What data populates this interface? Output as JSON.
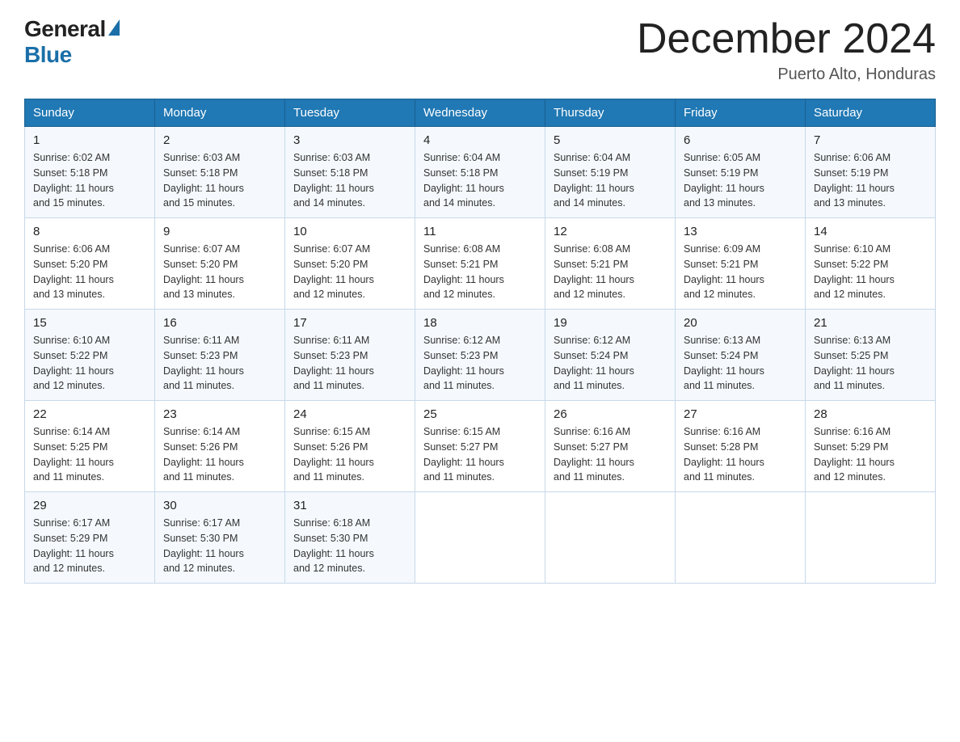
{
  "header": {
    "logo": {
      "text_general": "General",
      "text_blue": "Blue"
    },
    "title": "December 2024",
    "location": "Puerto Alto, Honduras"
  },
  "days_of_week": [
    "Sunday",
    "Monday",
    "Tuesday",
    "Wednesday",
    "Thursday",
    "Friday",
    "Saturday"
  ],
  "weeks": [
    [
      {
        "day": "1",
        "sunrise": "6:02 AM",
        "sunset": "5:18 PM",
        "daylight": "11 hours and 15 minutes."
      },
      {
        "day": "2",
        "sunrise": "6:03 AM",
        "sunset": "5:18 PM",
        "daylight": "11 hours and 15 minutes."
      },
      {
        "day": "3",
        "sunrise": "6:03 AM",
        "sunset": "5:18 PM",
        "daylight": "11 hours and 14 minutes."
      },
      {
        "day": "4",
        "sunrise": "6:04 AM",
        "sunset": "5:18 PM",
        "daylight": "11 hours and 14 minutes."
      },
      {
        "day": "5",
        "sunrise": "6:04 AM",
        "sunset": "5:19 PM",
        "daylight": "11 hours and 14 minutes."
      },
      {
        "day": "6",
        "sunrise": "6:05 AM",
        "sunset": "5:19 PM",
        "daylight": "11 hours and 13 minutes."
      },
      {
        "day": "7",
        "sunrise": "6:06 AM",
        "sunset": "5:19 PM",
        "daylight": "11 hours and 13 minutes."
      }
    ],
    [
      {
        "day": "8",
        "sunrise": "6:06 AM",
        "sunset": "5:20 PM",
        "daylight": "11 hours and 13 minutes."
      },
      {
        "day": "9",
        "sunrise": "6:07 AM",
        "sunset": "5:20 PM",
        "daylight": "11 hours and 13 minutes."
      },
      {
        "day": "10",
        "sunrise": "6:07 AM",
        "sunset": "5:20 PM",
        "daylight": "11 hours and 12 minutes."
      },
      {
        "day": "11",
        "sunrise": "6:08 AM",
        "sunset": "5:21 PM",
        "daylight": "11 hours and 12 minutes."
      },
      {
        "day": "12",
        "sunrise": "6:08 AM",
        "sunset": "5:21 PM",
        "daylight": "11 hours and 12 minutes."
      },
      {
        "day": "13",
        "sunrise": "6:09 AM",
        "sunset": "5:21 PM",
        "daylight": "11 hours and 12 minutes."
      },
      {
        "day": "14",
        "sunrise": "6:10 AM",
        "sunset": "5:22 PM",
        "daylight": "11 hours and 12 minutes."
      }
    ],
    [
      {
        "day": "15",
        "sunrise": "6:10 AM",
        "sunset": "5:22 PM",
        "daylight": "11 hours and 12 minutes."
      },
      {
        "day": "16",
        "sunrise": "6:11 AM",
        "sunset": "5:23 PM",
        "daylight": "11 hours and 11 minutes."
      },
      {
        "day": "17",
        "sunrise": "6:11 AM",
        "sunset": "5:23 PM",
        "daylight": "11 hours and 11 minutes."
      },
      {
        "day": "18",
        "sunrise": "6:12 AM",
        "sunset": "5:23 PM",
        "daylight": "11 hours and 11 minutes."
      },
      {
        "day": "19",
        "sunrise": "6:12 AM",
        "sunset": "5:24 PM",
        "daylight": "11 hours and 11 minutes."
      },
      {
        "day": "20",
        "sunrise": "6:13 AM",
        "sunset": "5:24 PM",
        "daylight": "11 hours and 11 minutes."
      },
      {
        "day": "21",
        "sunrise": "6:13 AM",
        "sunset": "5:25 PM",
        "daylight": "11 hours and 11 minutes."
      }
    ],
    [
      {
        "day": "22",
        "sunrise": "6:14 AM",
        "sunset": "5:25 PM",
        "daylight": "11 hours and 11 minutes."
      },
      {
        "day": "23",
        "sunrise": "6:14 AM",
        "sunset": "5:26 PM",
        "daylight": "11 hours and 11 minutes."
      },
      {
        "day": "24",
        "sunrise": "6:15 AM",
        "sunset": "5:26 PM",
        "daylight": "11 hours and 11 minutes."
      },
      {
        "day": "25",
        "sunrise": "6:15 AM",
        "sunset": "5:27 PM",
        "daylight": "11 hours and 11 minutes."
      },
      {
        "day": "26",
        "sunrise": "6:16 AM",
        "sunset": "5:27 PM",
        "daylight": "11 hours and 11 minutes."
      },
      {
        "day": "27",
        "sunrise": "6:16 AM",
        "sunset": "5:28 PM",
        "daylight": "11 hours and 11 minutes."
      },
      {
        "day": "28",
        "sunrise": "6:16 AM",
        "sunset": "5:29 PM",
        "daylight": "11 hours and 12 minutes."
      }
    ],
    [
      {
        "day": "29",
        "sunrise": "6:17 AM",
        "sunset": "5:29 PM",
        "daylight": "11 hours and 12 minutes."
      },
      {
        "day": "30",
        "sunrise": "6:17 AM",
        "sunset": "5:30 PM",
        "daylight": "11 hours and 12 minutes."
      },
      {
        "day": "31",
        "sunrise": "6:18 AM",
        "sunset": "5:30 PM",
        "daylight": "11 hours and 12 minutes."
      },
      null,
      null,
      null,
      null
    ]
  ],
  "sunrise_label": "Sunrise: ",
  "sunset_label": "Sunset: ",
  "daylight_label": "Daylight: "
}
